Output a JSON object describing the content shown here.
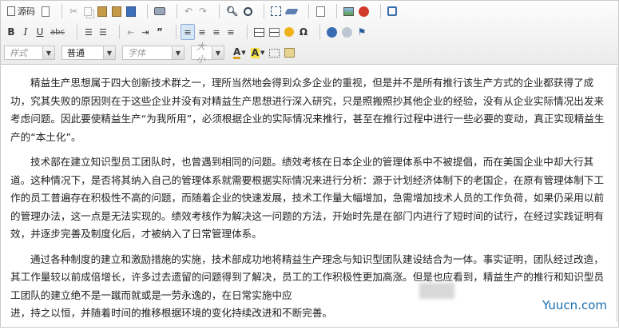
{
  "toolbar": {
    "source_label": "源码",
    "style_placeholder": "样式",
    "format_value": "普通",
    "font_placeholder": "字体",
    "size_placeholder": "大小",
    "bold_label": "B",
    "italic_label": "I",
    "underline_label": "U",
    "strike_label": "abc",
    "omega_label": "Ω",
    "text_color_label": "A",
    "bg_color_label": "A"
  },
  "icons": [
    "source-icon",
    "new-page-icon",
    "cut-icon",
    "copy-icon",
    "paste-icon",
    "paste-text-icon",
    "paste-word-icon",
    "print-icon",
    "undo-icon",
    "redo-icon",
    "find-icon",
    "replace-icon",
    "select-all-icon",
    "remove-format-icon",
    "spell-check-icon",
    "image-icon",
    "flash-icon",
    "maximize-icon",
    "ordered-list-icon",
    "unordered-list-icon",
    "outdent-icon",
    "indent-icon",
    "blockquote-icon",
    "align-left-icon",
    "align-center-icon",
    "align-right-icon",
    "justify-icon",
    "table-icon",
    "horizontal-rule-icon",
    "smiley-icon",
    "special-char-icon",
    "link-icon",
    "unlink-icon",
    "anchor-icon",
    "text-color-icon",
    "bg-color-icon",
    "show-blocks-icon",
    "template-icon"
  ],
  "content": {
    "p1": "精益生产思想属于四大创新技术群之一，理所当然地会得到众多企业的重视，但是并不是所有推行该生产方式的企业都获得了成功，究其失败的原因则在于这些企业并没有对精益生产思想进行深入研究，只是照搬照抄其他企业的经验，没有从企业实际情况出发来考虑问题。因此要使精益生产“为我所用”，必须根据企业的实际情况来推行，甚至在推行过程中进行一些必要的变动，真正实现精益生产的“本土化”。",
    "p2": "技术部在建立知识型员工团队时，也曾遇到相同的问题。绩效考核在日本企业的管理体系中不被提倡，而在美国企业中却大行其道。这种情况下，是否将其纳入自己的管理体系就需要根据实际情况来进行分析：源于计划经济体制下的老国企，在原有管理体制下工作的员工普遍存在积极性不高的问题，而随着企业的快速发展，技术工作量大幅增加，急需增加技术人员的工作负荷，如果仍采用以前的管理办法，这一点是无法实现的。绩效考核作为解决这一问题的方法，开始时先是在部门内进行了短时间的试行，在经过实践证明有效，并逐步完善及制度化后，才被纳入了日常管理体系。",
    "p3": "通过各种制度的建立和激励措施的实施，技术部成功地将精益生产理念与知识型团队建设结合为一体。事实证明，团队经过改造，其工作量较以前成倍增长，许多过去遗留的问题得到了解决，员工的工作积极性更加高涨。但是也应看到，精益生产的推行和知识型员工团队的建立绝不是一蹴而就或是一劳永逸的，在日常实施中应",
    "p3_end": "进，持之以恒，并随着时间的推移根据环境的变化持续改进和不断完善。"
  },
  "watermark": "Yuucn.com"
}
